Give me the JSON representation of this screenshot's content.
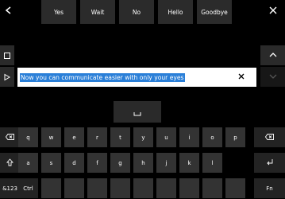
{
  "suggestions": [
    "Yes",
    "Wait",
    "No",
    "Hello",
    "Goodbye"
  ],
  "text_field": {
    "value": "Now you can communicate easier with only your eyes"
  },
  "icons": {
    "back": "back-icon",
    "close": "close-icon",
    "stop": "stop-icon",
    "play": "play-icon",
    "scroll_up": "chevron-up-icon",
    "scroll_down": "chevron-down-icon",
    "space": "space-icon",
    "clear": "clear-icon"
  },
  "keyboard": {
    "row1": [
      "q",
      "w",
      "e",
      "r",
      "t",
      "y",
      "u",
      "i",
      "o",
      "p"
    ],
    "row2": [
      "a",
      "s",
      "d",
      "f",
      "g",
      "h",
      "j",
      "k",
      "l"
    ],
    "row3_left": "&123",
    "row3_mid": "Ctrl",
    "row3_fn": "Fn"
  },
  "colors": {
    "selection": "#2A7FD8",
    "key": "#333333",
    "toolbar": "#2A2A2A",
    "background": "#000000"
  }
}
